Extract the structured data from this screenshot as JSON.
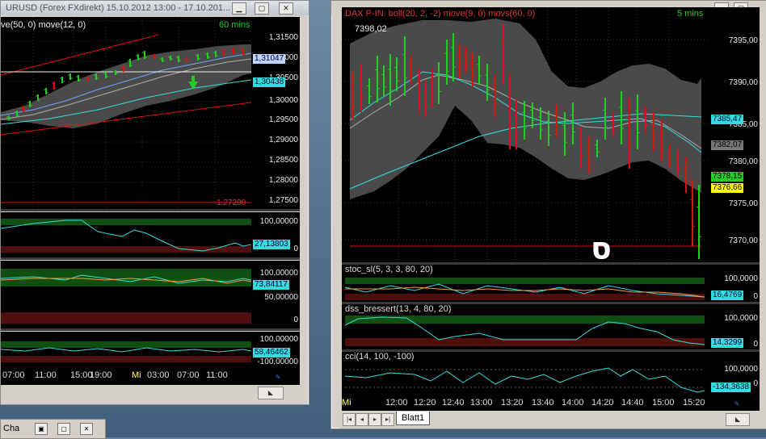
{
  "left_window": {
    "title": "URUSD (Forex FXdirekt) 15.10.2012 13:00 - 17.10.201...",
    "main_label": "ve(50, 0) move(12, 0)",
    "timeframe": "60 mins",
    "price_axis": [
      "1,31500",
      "1,31000",
      "1,30500",
      "1,30000",
      "1,29500",
      "1,29000",
      "1,28500",
      "1,28000",
      "1,27500"
    ],
    "tag_price_1": "1,31047",
    "tag_price_2": "1,30438",
    "red_level": "1,27290",
    "ind1_axis": [
      "100,00000",
      "0"
    ],
    "ind1_tag": "27,13803",
    "ind2_axis": [
      "100,00000",
      "50,00000",
      "0"
    ],
    "ind2_tag": "73,84117",
    "ind3_axis": [
      "100,00000",
      "-100,00000"
    ],
    "ind3_tag": "58,46462",
    "time_labels": [
      "07:00",
      "11:00",
      "15:00",
      "19:00",
      "Mi",
      "03:00",
      "07:00",
      "11:00"
    ]
  },
  "right_window": {
    "main_label": "DAX P-IN. boll(20, 2, -2) move(9, 0) movs(60, 0)",
    "timeframe": "5 mins",
    "last_price": "7398,02",
    "price_axis": [
      "7395,00",
      "7390,00",
      "7385,00",
      "7380,00",
      "7375,00",
      "7370,00"
    ],
    "tag_cyan": "7385,47",
    "tag_gray": "7382,07",
    "tag_green": "7378,15",
    "tag_yellow": "7376,66",
    "marker": "ס",
    "stoc_label": "stoc_sl(5, 3, 3, 80, 20)",
    "stoc_axis": [
      "100,0000",
      "0"
    ],
    "stoc_tag": "16,4769",
    "dss_label": "dss_bressert(13, 4, 80, 20)",
    "dss_axis": [
      "100,0000",
      "0"
    ],
    "dss_tag": "14,3299",
    "cci_label": "cci(14, 100, -100)",
    "cci_axis": [
      "100,0000",
      "0"
    ],
    "cci_tag": "-134,3638",
    "time_labels": [
      "Mi",
      "12:00",
      "12:20",
      "12:40",
      "13:00",
      "13:20",
      "13:40",
      "14:00",
      "14:20",
      "14:40",
      "15:00",
      "15:20"
    ],
    "sheet_tab": "Blatt1"
  },
  "taskbar": {
    "item1": "Cha",
    "colors": {
      "bull": "#22cc22",
      "bear": "#dd1111",
      "band": "#4a4a4a",
      "cyan": "#33dddd",
      "yellow": "#ffff00"
    }
  }
}
